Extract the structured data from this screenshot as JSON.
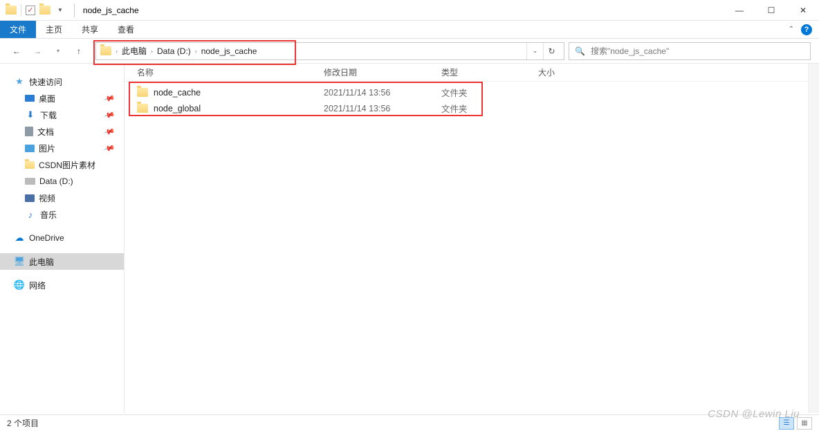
{
  "title": "node_js_cache",
  "ribbon": {
    "file": "文件",
    "home": "主页",
    "share": "共享",
    "view": "查看"
  },
  "breadcrumbs": [
    "此电脑",
    "Data (D:)",
    "node_js_cache"
  ],
  "search": {
    "placeholder": "搜索\"node_js_cache\""
  },
  "columns": {
    "name": "名称",
    "date": "修改日期",
    "type": "类型",
    "size": "大小"
  },
  "rows": [
    {
      "name": "node_cache",
      "date": "2021/11/14 13:56",
      "type": "文件夹"
    },
    {
      "name": "node_global",
      "date": "2021/11/14 13:56",
      "type": "文件夹"
    }
  ],
  "sidebar": {
    "quick_access": "快速访问",
    "desktop": "桌面",
    "downloads": "下载",
    "documents": "文档",
    "pictures": "图片",
    "csdn": "CSDN图片素材",
    "data_d": "Data (D:)",
    "videos": "视频",
    "music": "音乐",
    "onedrive": "OneDrive",
    "this_pc": "此电脑",
    "network": "网络"
  },
  "status": {
    "items": "2 个项目"
  },
  "watermark": "CSDN @Lewin Liu"
}
